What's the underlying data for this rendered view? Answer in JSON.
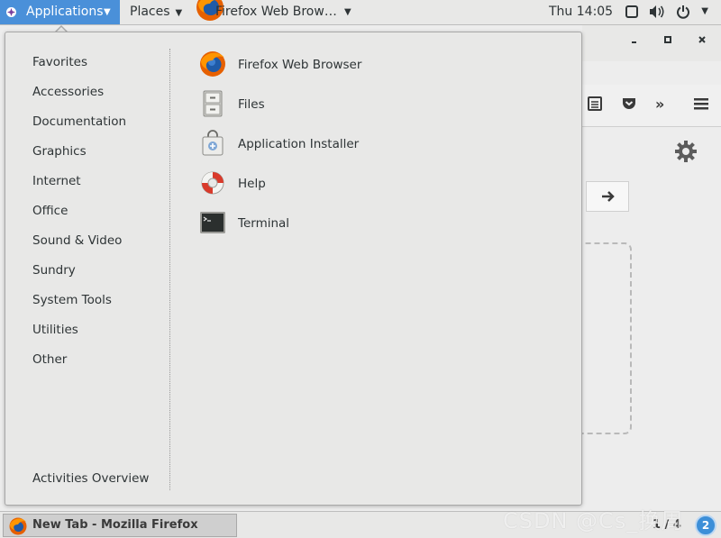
{
  "topbar": {
    "applications_label": "Applications",
    "places_label": "Places",
    "active_window_label": "Firefox Web Brow…",
    "clock": "Thu 14:05"
  },
  "menu": {
    "categories": [
      "Favorites",
      "Accessories",
      "Documentation",
      "Graphics",
      "Internet",
      "Office",
      "Sound & Video",
      "Sundry",
      "System Tools",
      "Utilities",
      "Other"
    ],
    "activities_overview": "Activities Overview",
    "apps": [
      {
        "label": "Firefox Web Browser",
        "icon": "firefox-icon"
      },
      {
        "label": "Files",
        "icon": "files-cabinet-icon"
      },
      {
        "label": "Application Installer",
        "icon": "software-bag-icon"
      },
      {
        "label": "Help",
        "icon": "lifebuoy-icon"
      },
      {
        "label": "Terminal",
        "icon": "terminal-icon"
      }
    ]
  },
  "taskbar": {
    "window_label": "New Tab - Mozilla Firefox",
    "pager": "1 / 4",
    "workspace_badge": "2"
  },
  "watermark": "CSDN @Cs_换周",
  "colors": {
    "accent": "#4a90d9",
    "panel": "#e8e8e7"
  }
}
